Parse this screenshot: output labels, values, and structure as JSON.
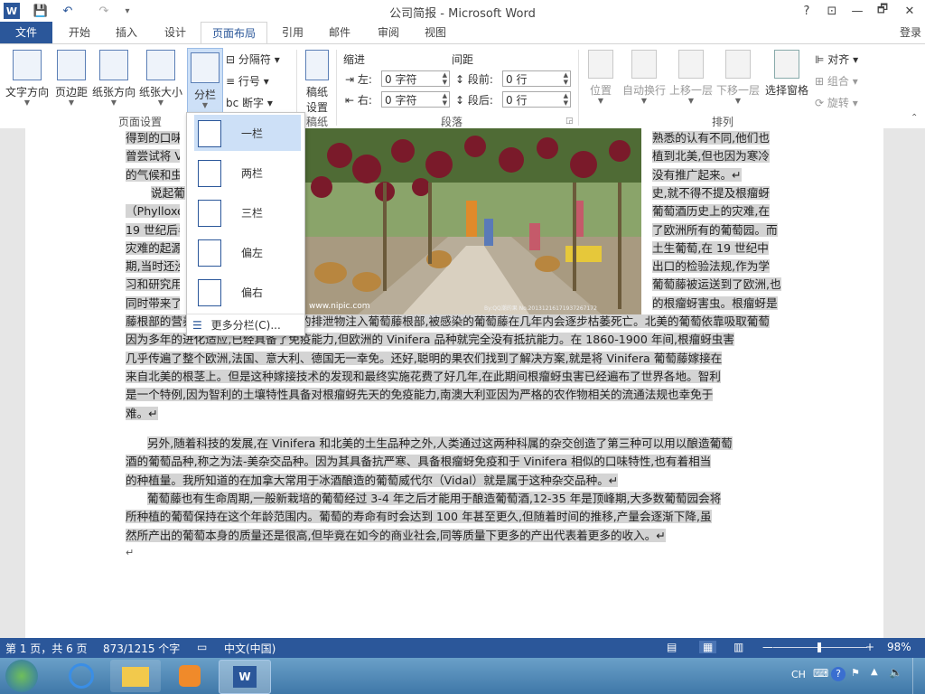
{
  "window": {
    "title": "公司简报 - Microsoft Word"
  },
  "title_controls": {
    "help": "?",
    "minimize": "—",
    "restore": "🗗",
    "close": "✕",
    "ribbon_opts": "⊡"
  },
  "qat": {
    "word_icon": "W",
    "save_icon": "💾",
    "undo_icon": "↶",
    "redo_icon": "↷",
    "customize_icon": "▾"
  },
  "tabs": {
    "file": "文件",
    "home": "开始",
    "insert": "插入",
    "design": "设计",
    "layout": "页面布局",
    "references": "引用",
    "mailings": "邮件",
    "review": "审阅",
    "view": "视图"
  },
  "login": "登录",
  "ribbon": {
    "page_setup": {
      "group_label": "页面设置",
      "text_direction": "文字方向",
      "margins": "页边距",
      "orientation": "纸张方向",
      "size": "纸张大小",
      "columns": "分栏",
      "breaks": "分隔符",
      "line_numbers": "行号",
      "hyphenation": "断字"
    },
    "draft": {
      "group_label": "稿纸",
      "label_line1": "稿纸",
      "label_line2": "设置"
    },
    "paragraph": {
      "group_label": "段落",
      "indent_title": "缩进",
      "spacing_title": "间距",
      "left_label": "左:",
      "right_label": "右:",
      "left_value": "0 字符",
      "right_value": "0 字符",
      "before_label": "段前:",
      "after_label": "段后:",
      "before_value": "0 行",
      "after_value": "0 行"
    },
    "arrange": {
      "group_label": "排列",
      "position": "位置",
      "wrap_text": "自动换行",
      "bring_forward": "上移一层",
      "send_backward": "下移一层",
      "selection_pane": "选择窗格",
      "align": "对齐",
      "group": "组合",
      "rotate": "旋转"
    }
  },
  "columns_menu": {
    "items": [
      "一栏",
      "两栏",
      "三栏",
      "偏左",
      "偏右"
    ],
    "more": "更多分栏(C)..."
  },
  "document": {
    "lines_top": [
      {
        "left": "得到的口味",
        "right": "熟悉的认有不同,他们也"
      },
      {
        "left": "曾尝试将 V",
        "right": "植到北美,但也因为寒冷"
      },
      {
        "left": "的气候和虫",
        "right": "没有推广起来。↵"
      },
      {
        "left": "说起葡",
        "right": "史,就不得不提及根瘤蚜"
      },
      {
        "left": "（Phylloxera",
        "right": "葡萄酒历史上的灾难,在"
      },
      {
        "left": "19 世纪后半",
        "right": "了欧洲所有的葡萄园。而"
      },
      {
        "left": "灾难的起源",
        "right": "土生葡萄,在 19 世纪中"
      },
      {
        "left": "期,当时还没",
        "right": "出口的检验法规,作为学"
      },
      {
        "left": "习和研究用",
        "right": "葡萄藤被运送到了欧洲,也"
      },
      {
        "left": "同时带来了",
        "right": "的根瘤蚜害虫。根瘤蚜是"
      },
      {
        "left": "一种寄居在",
        "right": "的寄生虫,依靠吸取葡萄"
      }
    ],
    "para_rest": [
      "藤根部的营养生存,同时释放有毒素的排泄物注入葡萄藤根部,被感染的葡萄藤在几年内会逐步枯萎死亡。北美的葡萄",
      "因为多年的进化适应,已经具备了免疫能力,但欧洲的 Vinifera 品种就完全没有抵抗能力。在 1860-1900 年间,根瘤蚜虫害",
      "几乎传遍了整个欧洲,法国、意大利、德国无一幸免。还好,聪明的果农们找到了解决方案,就是将 Vinifera 葡萄藤嫁接在",
      "来自北美的根茎上。但是这种嫁接技术的发现和最终实施花费了好几年,在此期间根瘤蚜虫害已经遍布了世界各地。智利",
      "是一个特例,因为智利的土壤特性具备对根瘤蚜先天的免疫能力,南澳大利亚因为严格的农作物相关的流通法规也幸免于",
      "难。↵"
    ],
    "para2": [
      "另外,随着科技的发展,在 Vinifera 和北美的土生品种之外,人类通过这两种科属的杂交创造了第三种可以用以酿造葡萄",
      "酒的葡萄品种,称之为法-美杂交品种。因为其具备抗严寒、具备根瘤蚜免疫和于 Vinifera 相似的口味特性,也有着相当",
      "的种植量。我所知道的在加拿大常用于冰酒酿造的葡萄威代尔（Vidal）就是属于这种杂交品种。↵"
    ],
    "para3": [
      "葡萄藤也有生命周期,一般新栽培的葡萄经过 3-4 年之后才能用于酿造葡萄酒,12-35 年是顶峰期,大多数葡萄园会将",
      "所种植的葡萄保持在这个年龄范围内。葡萄的寿命有时会达到 100 年甚至更久,但随着时间的推移,产量会逐渐下降,虽",
      "然所产出的葡萄本身的质量还是很高,但毕竟在如今的商业社会,同等质量下更多的产出代表着更多的收入。↵"
    ],
    "end_mark": "↵",
    "photo_watermark": "www.nipic.com",
    "photo_stamp": "By:QQ潮的果 No.20131216171937267172"
  },
  "status": {
    "page": "第 1 页，共 6 页",
    "words": "873/1215 个字",
    "language": "中文(中国)",
    "zoom": "98%",
    "zoom_level": 0.49
  },
  "taskbar": {
    "tray_lang": "CH",
    "word_icon": "W"
  },
  "colors": {
    "accent": "#2b579a",
    "highlight": "#d4d4d4"
  }
}
